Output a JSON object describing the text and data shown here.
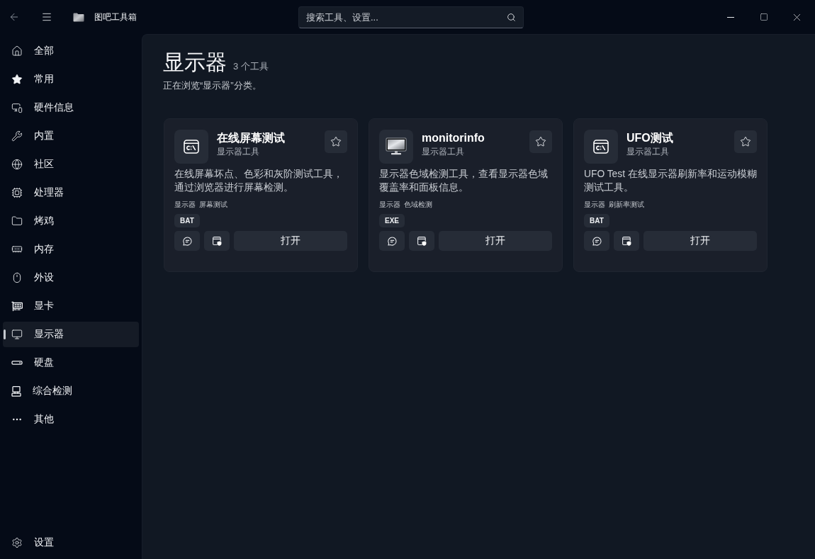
{
  "window": {
    "title": "图吧工具箱"
  },
  "search": {
    "placeholder": "搜索工具、设置..."
  },
  "sidebar": {
    "items": [
      {
        "label": "全部",
        "selected": false
      },
      {
        "label": "常用",
        "selected": false
      },
      {
        "label": "硬件信息",
        "selected": false
      },
      {
        "label": "内置",
        "selected": false
      },
      {
        "label": "社区",
        "selected": false
      },
      {
        "label": "处理器",
        "selected": false
      },
      {
        "label": "烤鸡",
        "selected": false
      },
      {
        "label": "内存",
        "selected": false
      },
      {
        "label": "外设",
        "selected": false
      },
      {
        "label": "显卡",
        "selected": false
      },
      {
        "label": "显示器",
        "selected": true
      },
      {
        "label": "硬盘",
        "selected": false
      },
      {
        "label": "综合检测",
        "selected": false
      },
      {
        "label": "其他",
        "selected": false
      }
    ],
    "footer_item": {
      "label": "设置"
    }
  },
  "page": {
    "title": "显示器",
    "count": "3 个工具",
    "subtitle": "正在浏览“显示器”分类。"
  },
  "tools": [
    {
      "name": "在线屏幕测试",
      "category": "显示器工具",
      "description": "在线屏幕坏点、色彩和灰阶测试工具，通过浏览器进行屏幕检测。",
      "tags": [
        "显示器",
        "屏幕测试"
      ],
      "file_type": "BAT",
      "favorite": false,
      "open_button": "打开"
    },
    {
      "name": "monitorinfo",
      "category": "显示器工具",
      "description": "显示器色域检测工具，查看显示器色域覆盖率和面板信息。",
      "tags": [
        "显示器",
        "色域检测"
      ],
      "file_type": "EXE",
      "favorite": false,
      "open_button": "打开"
    },
    {
      "name": "UFO测试",
      "category": "显示器工具",
      "description": "UFO Test 在线显示器刷新率和运动模糊测试工具。",
      "tags": [
        "显示器",
        "刷新率测试"
      ],
      "file_type": "BAT",
      "favorite": false,
      "open_button": "打开"
    }
  ]
}
